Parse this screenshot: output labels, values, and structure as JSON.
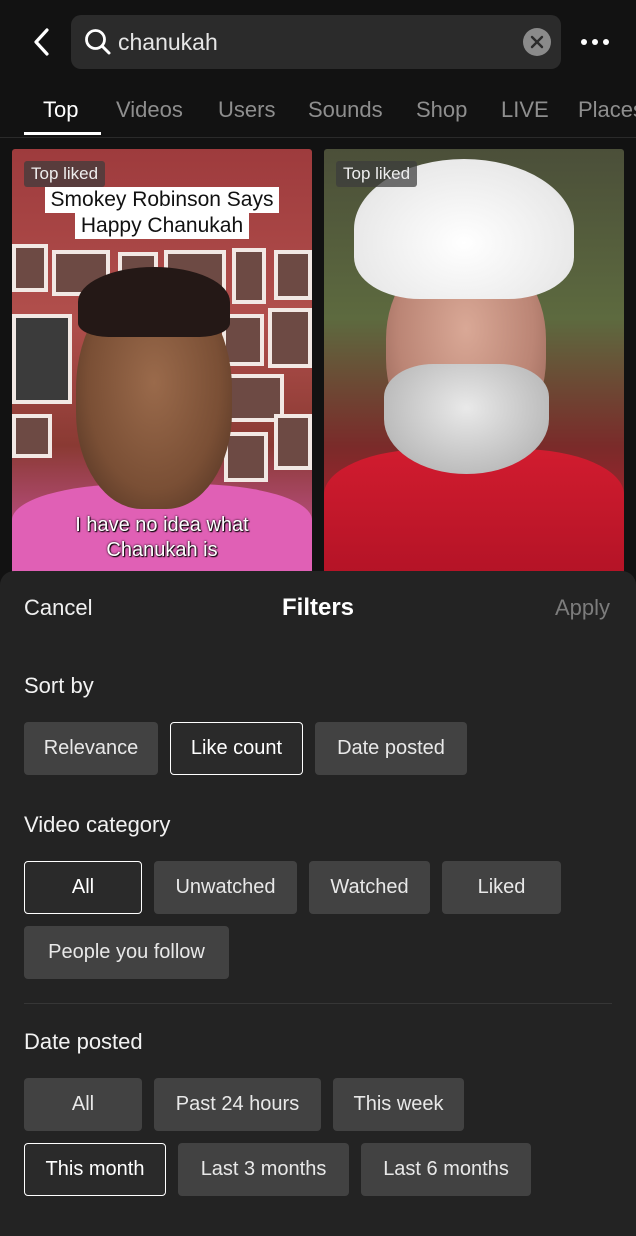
{
  "search": {
    "query": "chanukah"
  },
  "tabs": [
    {
      "label": "Top",
      "active": true
    },
    {
      "label": "Videos"
    },
    {
      "label": "Users"
    },
    {
      "label": "Sounds"
    },
    {
      "label": "Shop"
    },
    {
      "label": "LIVE"
    },
    {
      "label": "Places"
    }
  ],
  "videos": [
    {
      "badge": "Top liked",
      "caption_top": [
        "Smokey Robinson Says",
        "Happy Chanukah"
      ],
      "caption_bottom": [
        "I have no idea what",
        "Chanukah is"
      ]
    },
    {
      "badge": "Top liked"
    }
  ],
  "filters": {
    "cancel_label": "Cancel",
    "title": "Filters",
    "apply_label": "Apply",
    "sort_by": {
      "title": "Sort by",
      "options": [
        "Relevance",
        "Like count",
        "Date posted"
      ],
      "selected": "Like count"
    },
    "video_category": {
      "title": "Video category",
      "options": [
        "All",
        "Unwatched",
        "Watched",
        "Liked",
        "People you follow"
      ],
      "selected": "All"
    },
    "date_posted": {
      "title": "Date posted",
      "options": [
        "All",
        "Past 24 hours",
        "This week",
        "This month",
        "Last 3 months",
        "Last 6 months"
      ],
      "selected": "This month"
    }
  },
  "colors": {
    "background": "#121212",
    "sheet": "#232323",
    "chip": "#424242",
    "apply_disabled": "#7c7c7c"
  }
}
